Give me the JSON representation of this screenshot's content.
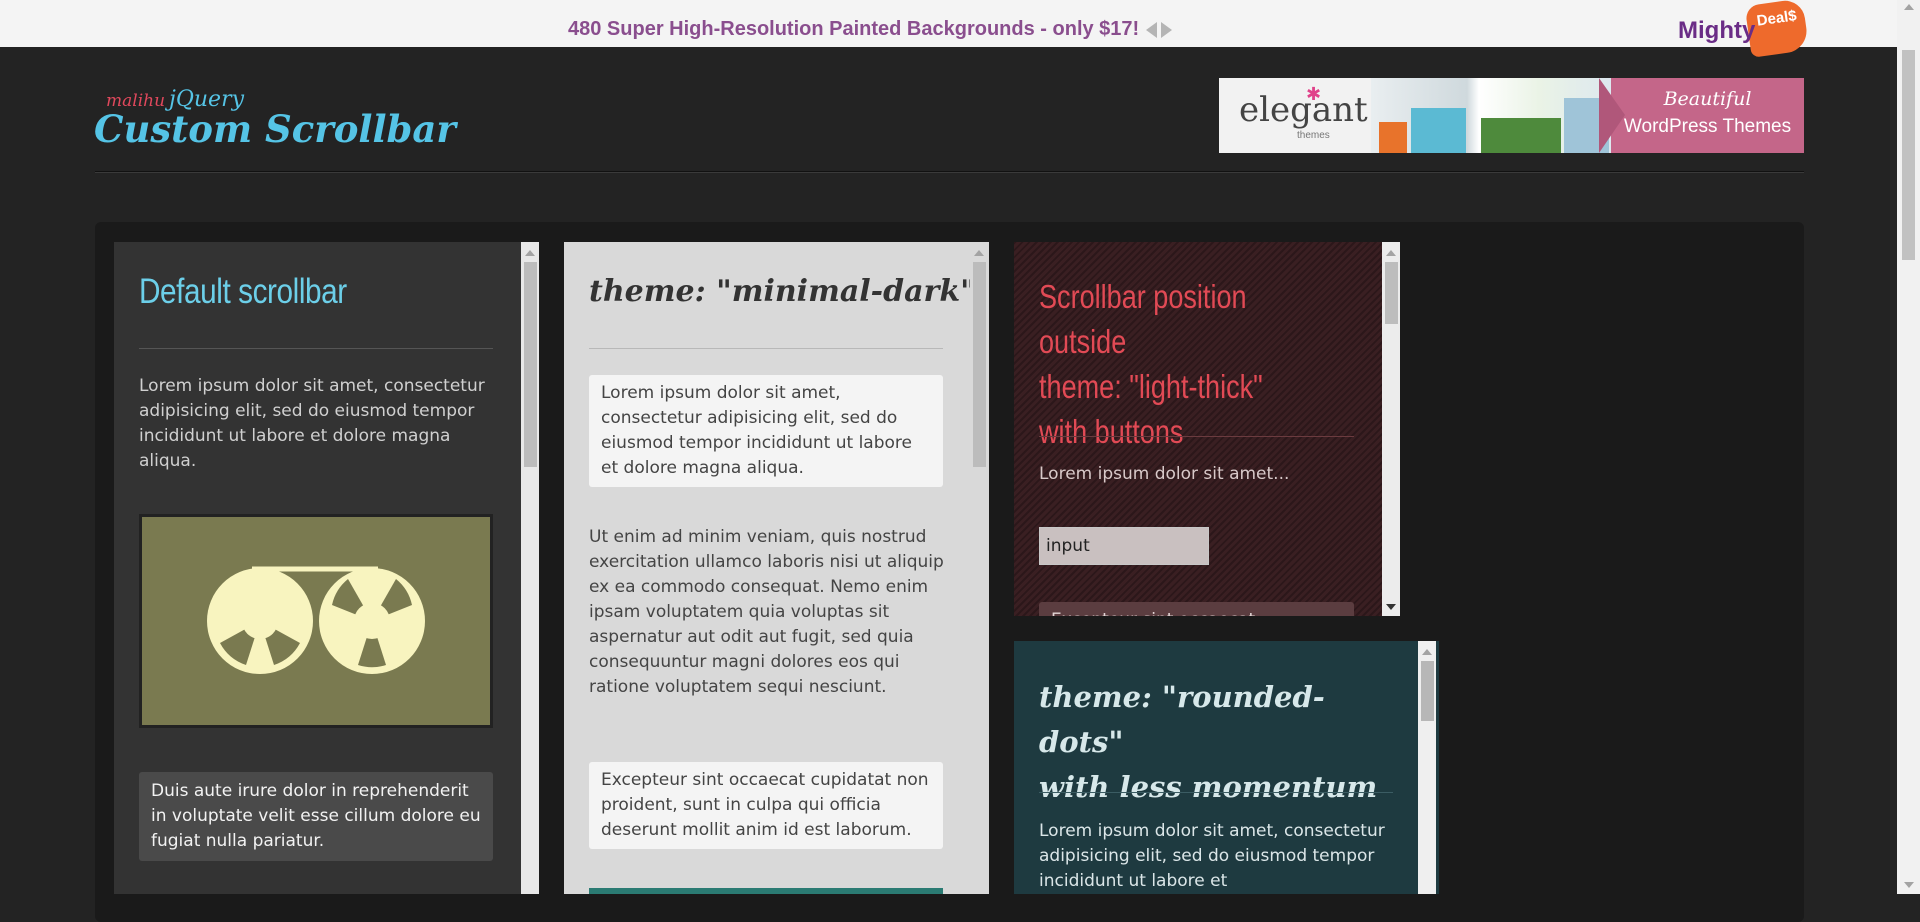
{
  "top_bar": {
    "promo_text": "480 Super High-Resolution Painted Backgrounds - only $17!",
    "sponsor_word": "Mighty",
    "sponsor_tag": "Deal$"
  },
  "logo": {
    "prefix": "malihu",
    "library": "jQuery",
    "title": "Custom Scrollbar"
  },
  "ad": {
    "brand": "elegant",
    "brand_sub": "themes",
    "line1": "Beautiful",
    "line2": "WordPress Themes"
  },
  "boxes": {
    "default": {
      "title": "Default scrollbar",
      "paragraph": "Lorem ipsum dolor sit amet, consectetur adipisicing elit, sed do eiusmod tempor incididunt ut labore et dolore magna aliqua.",
      "note": "Duis aute irure dolor in reprehenderit in voluptate velit esse cillum dolore eu fugiat nulla pariatur."
    },
    "minimal_dark": {
      "title": "theme: \"minimal-dark\"",
      "card1": "Lorem ipsum dolor sit amet, consectetur adipisicing elit, sed do eiusmod tempor incididunt ut labore et dolore magna aliqua.",
      "paragraph": "Ut enim ad minim veniam, quis nostrud exercitation ullamco laboris nisi ut aliquip ex ea commodo consequat. Nemo enim ipsam voluptatem quia voluptas sit aspernatur aut odit aut fugit, sed quia consequuntur magni dolores eos qui ratione voluptatem sequi nesciunt.",
      "card2": "Excepteur sint occaecat cupidatat non proident, sunt in culpa qui officia deserunt mollit anim id est laborum."
    },
    "light_thick": {
      "title_line1": "Scrollbar position outside",
      "title_line2": "theme: \"light-thick\"",
      "title_line3": "with buttons",
      "paragraph": "Lorem ipsum dolor sit amet...",
      "input_value": "input",
      "peek_text": "Excepteur sint occaecat"
    },
    "rounded_dots": {
      "title_line1": "theme: \"rounded-dots\"",
      "title_line2": "with less momentum",
      "paragraph": "Lorem ipsum dolor sit amet, consectetur adipisicing elit, sed do eiusmod tempor incididunt ut labore et"
    }
  }
}
